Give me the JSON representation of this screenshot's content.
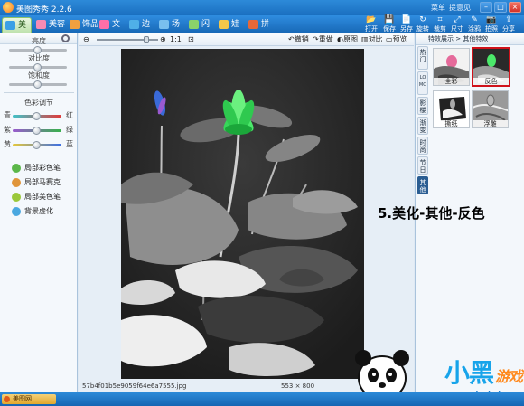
{
  "window": {
    "title": "美图秀秀 2.2.6",
    "links": [
      "菜单",
      "提意见"
    ],
    "buttons": {
      "minimize": "–",
      "maximize": "□",
      "close": "×"
    }
  },
  "tabs": [
    {
      "label": "美化",
      "icon": "beautify-icon",
      "color": "#3aa0e6",
      "active": true
    },
    {
      "label": "美容",
      "icon": "face-icon",
      "color": "#f58bb4",
      "active": false
    },
    {
      "label": "饰品",
      "icon": "ornament-icon",
      "color": "#f0a040",
      "active": false
    },
    {
      "label": "文字",
      "icon": "text-icon",
      "color": "#ff6fa8",
      "active": false
    },
    {
      "label": "边框",
      "icon": "frame-icon",
      "color": "#4fb0e8",
      "active": false
    },
    {
      "label": "场景",
      "icon": "scene-icon",
      "color": "#7ac0ee",
      "active": false
    },
    {
      "label": "闪图",
      "icon": "flash-icon",
      "color": "#8ad36a",
      "active": false
    },
    {
      "label": "娃娃",
      "icon": "doll-icon",
      "color": "#f3c84a",
      "active": false
    },
    {
      "label": "拼图",
      "icon": "puzzle-icon",
      "color": "#e6683a",
      "active": false
    }
  ],
  "toolbar": [
    {
      "label": "打开",
      "icon": "folder-icon",
      "glyph": "📂"
    },
    {
      "label": "保存",
      "icon": "save-icon",
      "glyph": "💾"
    },
    {
      "label": "另存",
      "icon": "save-as-icon",
      "glyph": "📄"
    },
    {
      "label": "旋转",
      "icon": "rotate-icon",
      "glyph": "↻"
    },
    {
      "label": "裁剪",
      "icon": "crop-icon",
      "glyph": "⌗"
    },
    {
      "label": "尺寸",
      "icon": "resize-icon",
      "glyph": "⤢"
    },
    {
      "label": "涂鸦",
      "icon": "doodle-icon",
      "glyph": "✎"
    },
    {
      "label": "拍照",
      "icon": "camera-icon",
      "glyph": "📷"
    },
    {
      "label": "分享",
      "icon": "share-icon",
      "glyph": "⇪"
    }
  ],
  "left_panel": {
    "sliders": [
      {
        "label": "亮度",
        "value": 0.5
      },
      {
        "label": "对比度",
        "value": 0.5
      },
      {
        "label": "饱和度",
        "value": 0.5
      }
    ],
    "color_section_title": "色彩调节",
    "color_sliders": [
      {
        "left": "青",
        "right": "红",
        "from": "#3fc3c8",
        "to": "#e23a3a",
        "value": 0.5
      },
      {
        "left": "紫",
        "right": "绿",
        "from": "#9a5ad0",
        "to": "#36b24a",
        "value": 0.5
      },
      {
        "left": "黄",
        "right": "蓝",
        "from": "#e6c83a",
        "to": "#3a6ee6",
        "value": 0.5
      }
    ],
    "brushes": [
      {
        "label": "局部彩色笔",
        "icon": "color-brush-icon",
        "color": "#5bb74a"
      },
      {
        "label": "局部马赛克",
        "icon": "mosaic-icon",
        "color": "#e0953a"
      },
      {
        "label": "局部美色笔",
        "icon": "beauty-brush-icon",
        "color": "#9ac83a"
      },
      {
        "label": "背景虚化",
        "icon": "blur-icon",
        "color": "#4aa8e0"
      }
    ]
  },
  "canvas": {
    "zoom_label": "1:1",
    "actions": [
      {
        "label": "撤销",
        "icon": "undo-icon",
        "glyph": "↶"
      },
      {
        "label": "重做",
        "icon": "redo-icon",
        "glyph": "↷"
      },
      {
        "label": "原图",
        "icon": "original-icon",
        "glyph": "◐"
      },
      {
        "label": "对比",
        "icon": "compare-icon",
        "glyph": "▥"
      },
      {
        "label": "预览",
        "icon": "preview-icon",
        "glyph": "▭"
      }
    ],
    "file_name": "57b4f01b5e9059f64e6a7555.jpg",
    "dimensions": "553 × 800"
  },
  "right_panel": {
    "breadcrumb": "特效展示 > 其他特效",
    "nav_tabs": [
      "热门",
      "LOMO",
      "影楼",
      "渐变",
      "时尚",
      "节日",
      "其他"
    ],
    "active_nav": 6,
    "effects": [
      {
        "label": "全彩",
        "selected": false
      },
      {
        "label": "反色",
        "selected": true
      },
      {
        "label": "撕纸",
        "selected": false
      },
      {
        "label": "浮雕",
        "selected": false
      }
    ]
  },
  "annotation": "5.美化-其他-反色",
  "watermark": {
    "logo_main": "小黑",
    "logo_sub": "游戏",
    "url": "www.xiaohei.com"
  },
  "taskbar": {
    "item_label": "美图网"
  }
}
